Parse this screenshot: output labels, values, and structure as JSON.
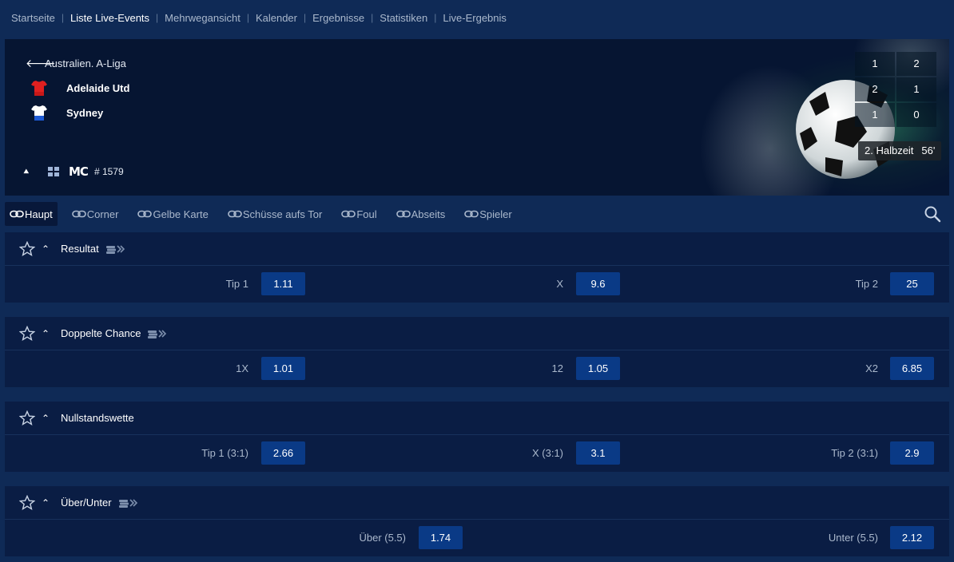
{
  "breadcrumb": [
    {
      "label": "Startseite"
    },
    {
      "label": "Liste Live-Events",
      "active": true
    },
    {
      "label": "Mehrwegansicht"
    },
    {
      "label": "Kalender"
    },
    {
      "label": "Ergebnisse"
    },
    {
      "label": "Statistiken"
    },
    {
      "label": "Live-Ergebnis"
    }
  ],
  "match": {
    "league": "Australien. A-Liga",
    "home_team": "Adelaide Utd",
    "away_team": "Sydney",
    "home_shirt_color": "#e02020",
    "away_shirt_color": "#ffffff",
    "away_shorts_color": "#1e5bd6",
    "match_id": "# 1579",
    "logo_text": "MC",
    "score_header": [
      "1",
      "2"
    ],
    "score_rows": [
      [
        "2",
        "1"
      ],
      [
        "1",
        "0"
      ]
    ],
    "period": "2. Halbzeit",
    "minute": "56'"
  },
  "tabs": [
    {
      "label": "Haupt",
      "active": true
    },
    {
      "label": "Corner"
    },
    {
      "label": "Gelbe Karte"
    },
    {
      "label": "Schüsse aufs Tor"
    },
    {
      "label": "Foul"
    },
    {
      "label": "Abseits"
    },
    {
      "label": "Spieler"
    }
  ],
  "markets": [
    {
      "title": "Resultat",
      "cashout": true,
      "selections": [
        {
          "label": "Tip 1",
          "odds": "1.11"
        },
        {
          "label": "X",
          "odds": "9.6"
        },
        {
          "label": "Tip 2",
          "odds": "25"
        }
      ]
    },
    {
      "title": "Doppelte Chance",
      "cashout": true,
      "selections": [
        {
          "label": "1X",
          "odds": "1.01"
        },
        {
          "label": "12",
          "odds": "1.05"
        },
        {
          "label": "X2",
          "odds": "6.85"
        }
      ]
    },
    {
      "title": "Nullstandswette",
      "cashout": false,
      "selections": [
        {
          "label": "Tip 1 (3:1)",
          "odds": "2.66"
        },
        {
          "label": "X (3:1)",
          "odds": "3.1"
        },
        {
          "label": "Tip 2 (3:1)",
          "odds": "2.9"
        }
      ]
    },
    {
      "title": "Über/Unter",
      "cashout": true,
      "selections": [
        {
          "label": "Über (5.5)",
          "odds": "1.74"
        },
        {
          "label": "Unter (5.5)",
          "odds": "2.12"
        }
      ]
    }
  ],
  "colors": {
    "page_bg": "#0f2a56",
    "panel_bg": "#0a1d44",
    "odds_bg": "#0a3a86",
    "header_bg": "#061532"
  }
}
